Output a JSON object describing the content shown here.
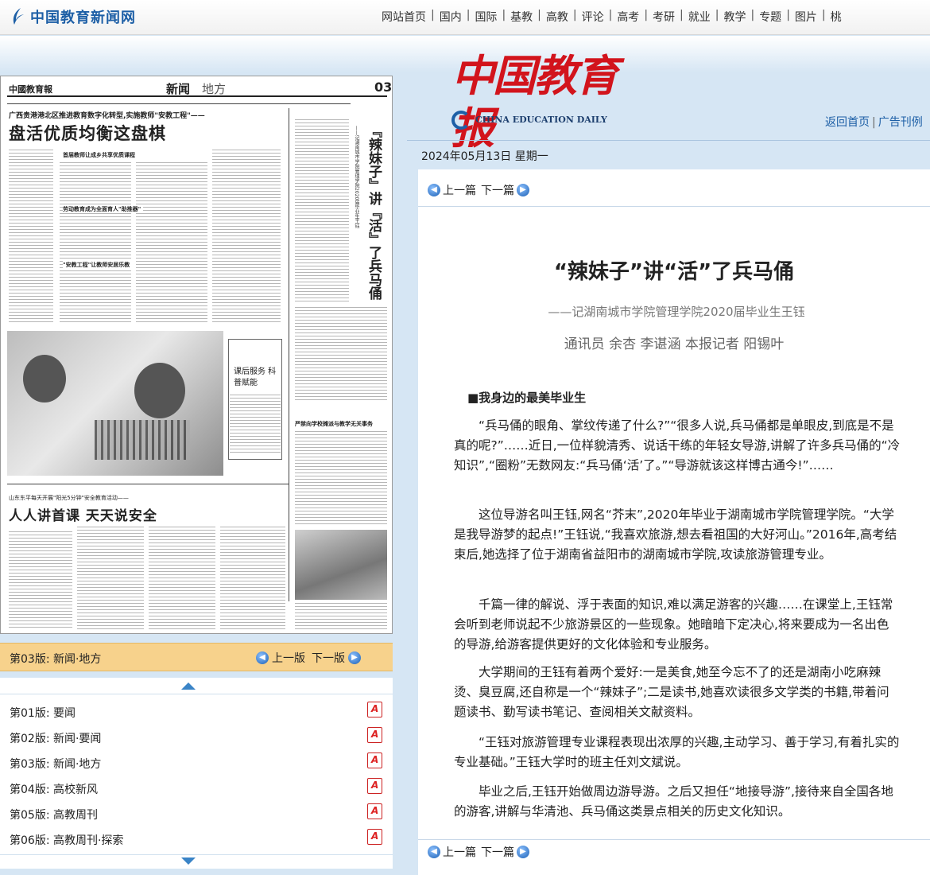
{
  "site": {
    "logo_text": "中国教育新闻网",
    "nav": [
      "网站首页",
      "国内",
      "国际",
      "基教",
      "高教",
      "评论",
      "高考",
      "考研",
      "就业",
      "教学",
      "专题",
      "图片",
      "桃"
    ]
  },
  "newspaper": {
    "masthead": "中国教育报",
    "masthead_en": "CHINA EDUCATION DAILY",
    "links": {
      "home": "返回首页",
      "archive": "广告刊例",
      "sep": "|"
    },
    "date": "2024年05月13日 星期一"
  },
  "page_image": {
    "header_logo": "中國教育報",
    "section": "新闻",
    "section_sub": "地方",
    "page_number": "03",
    "kicker": "广西贵港港北区推进教育数字化转型,实施教师\"安教工程\"——",
    "headline": "盘活优质均衡这盘棋",
    "sub1": "首届教师让成乡共享优质课程",
    "sub2": "劳动教育成为全面育人\"助推器\"",
    "sub3": "\"安教工程\"让教师安居乐教",
    "vertical_title": "『辣妹子』讲『活』了兵马俑",
    "vertical_sub": "——记湖南城市学院管理学院2020届毕业生王钰",
    "box_title": "课后服务 科普赋能",
    "kicker2": "山东东平每天开展\"阳光5分钟\"安全教育活动——",
    "headline2": "人人讲首课 天天说安全",
    "right_col_title": "严禁向学校摊派与教学无关事务"
  },
  "current_page": {
    "label": "第03版:  新闻·地方",
    "prev": "上一版",
    "next": "下一版"
  },
  "page_list": [
    {
      "label": "第01版:  要闻"
    },
    {
      "label": "第02版:  新闻·要闻"
    },
    {
      "label": "第03版:  新闻·地方"
    },
    {
      "label": "第04版:  高校新风"
    },
    {
      "label": "第05版:  高教周刊"
    },
    {
      "label": "第06版:  高教周刊·探索"
    }
  ],
  "article": {
    "prev": "上一篇",
    "next": "下一篇",
    "title": "“辣妹子”讲“活”了兵马俑",
    "subtitle": "——记湖南城市学院管理学院2020届毕业生王钰",
    "byline": "通讯员 余杏 李谌涵 本报记者 阳锡叶",
    "section": "■我身边的最美毕业生",
    "paragraphs": [
      "“兵马俑的眼角、掌纹传递了什么?”“很多人说,兵马俑都是单眼皮,到底是不是真的呢?”……近日,一位样貌清秀、说话干练的年轻女导游,讲解了许多兵马俑的“冷知识”,“圈粉”无数网友:“兵马俑‘活’了。”“导游就该这样博古通今!”……",
      "这位导游名叫王钰,网名“芥末”,2020年毕业于湖南城市学院管理学院。“大学是我导游梦的起点!”王钰说,“我喜欢旅游,想去看祖国的大好河山。”2016年,高考结束后,她选择了位于湖南省益阳市的湖南城市学院,攻读旅游管理专业。",
      "千篇一律的解说、浮于表面的知识,难以满足游客的兴趣……在课堂上,王钰常会听到老师说起不少旅游景区的一些现象。她暗暗下定决心,将来要成为一名出色的导游,给游客提供更好的文化体验和专业服务。",
      "大学期间的王钰有着两个爱好:一是美食,她至今忘不了的还是湖南小吃麻辣烫、臭豆腐,还自称是一个“辣妹子”;二是读书,她喜欢读很多文学类的书籍,带着问题读书、勤写读书笔记、查阅相关文献资料。",
      "“王钰对旅游管理专业课程表现出浓厚的兴趣,主动学习、善于学习,有着扎实的专业基础。”王钰大学时的班主任刘文斌说。",
      "毕业之后,王钰开始做周边游导游。之后又担任“地接导游”,接待来自全国各地的游客,讲解与华清池、兵马俑这类景点相关的历史文化知识。"
    ]
  },
  "colors": {
    "accent": "#1d5fa6",
    "masthead_red": "#d2141c",
    "current_bar": "#f7d28c"
  },
  "icons": [
    "arrow-left-circle-icon",
    "arrow-right-circle-icon",
    "pdf-icon",
    "scroll-up-icon",
    "scroll-down-icon"
  ]
}
